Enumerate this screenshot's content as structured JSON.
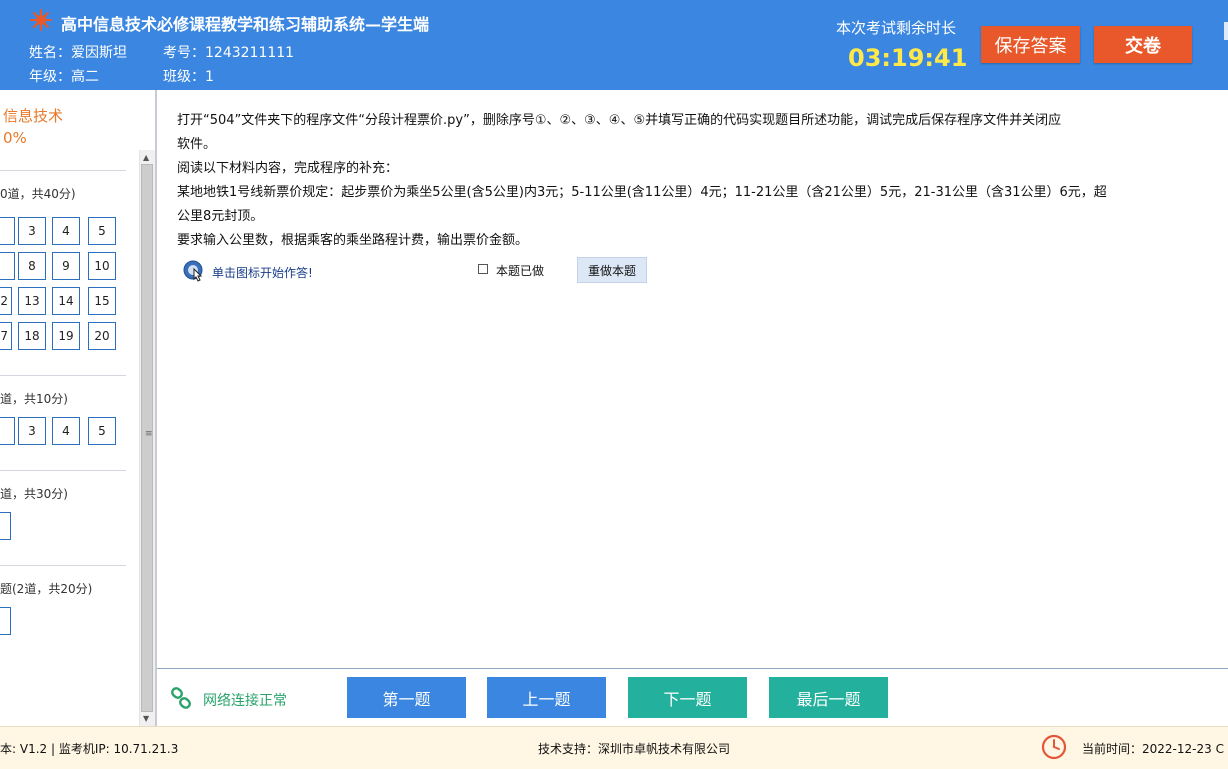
{
  "header": {
    "title": "高中信息技术必修课程教学和练习辅助系统—学生端",
    "name_label": "姓名：",
    "name": "爱因斯坦",
    "id_label": "考号：",
    "id": "1243211111",
    "grade_label": "年级：",
    "grade": "高二",
    "class_label": "班级：",
    "class": "1",
    "remaining_label": "本次考试剩余时长",
    "remaining_time": "03:19:41",
    "save_label": "保存答案",
    "submit_label": "交卷"
  },
  "sidebar": {
    "subject": "信息技术",
    "progress": "0%",
    "sections": [
      {
        "header": "0道，共40分)",
        "numbers": [
          "3",
          "4",
          "5",
          "8",
          "9",
          "10",
          "2",
          "13",
          "14",
          "15",
          "7",
          "18",
          "19",
          "20"
        ]
      },
      {
        "header": "道，共10分)",
        "numbers": [
          "3",
          "4",
          "5"
        ]
      },
      {
        "header": "道，共30分)"
      },
      {
        "header": "题(2道，共20分)"
      }
    ]
  },
  "question": {
    "lines": [
      "打开“504”文件夹下的程序文件“分段计程票价.py”，删除序号①、②、③、④、⑤并填写正确的代码实现题目所述功能，调试完成后保存程序文件并关闭应",
      "软件。",
      "阅读以下材料内容，完成程序的补充：",
      "某地地铁1号线新票价规定：起步票价为乘坐5公里(含5公里)内3元；5-11公里(含11公里）4元；11-21公里（含21公里）5元，21-31公里（含31公里）6元，超",
      "公里8元封顶。",
      "要求输入公里数，根据乘客的乘坐路程计费，输出票价金额。"
    ],
    "start_answer": "单击图标开始作答!",
    "done_label": "本题已做",
    "redo_label": "重做本题"
  },
  "nav": {
    "network_status": "网络连接正常",
    "first": "第一题",
    "prev": "上一题",
    "next": "下一题",
    "last": "最后一题"
  },
  "status": {
    "version": "本: V1.2 | 监考机IP: 10.71.21.3",
    "support": "技术支持：深圳市卓帆技术有限公司",
    "time_label": "当前时间：",
    "time_value": "2022-12-23 C"
  },
  "colors": {
    "header_blue": "#3a86e0",
    "orange_button": "#e8582a",
    "timer_yellow": "#ffe94a",
    "teal_button": "#23b09c",
    "network_green": "#2aa36b",
    "subject_orange": "#e8782a"
  },
  "icons": {
    "logo": "snowflake-logo-icon",
    "answer": "hand-pointer-icon",
    "network": "link-icon",
    "clock": "clock-icon"
  }
}
